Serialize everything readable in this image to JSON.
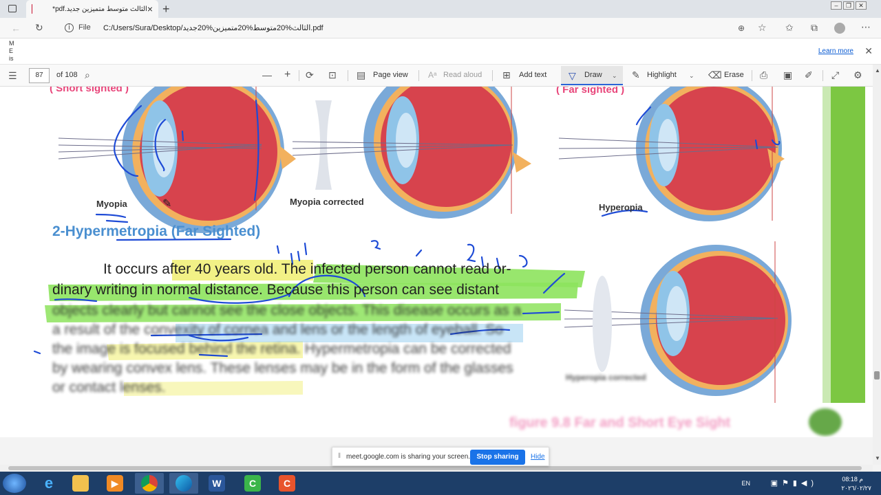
{
  "browser": {
    "tab_title": "الثالث متوسط متميزين جديد.pdf*",
    "file_label": "File",
    "url": "C:/Users/Sura/Desktop/الثالث%20متوسط%20متميزين%20جديد.pdf",
    "learn_more": "Learn more",
    "side_letters": "M E is"
  },
  "pdf_toolbar": {
    "page_number": "87",
    "page_total": "of 108",
    "page_view": "Page view",
    "read_aloud": "Read aloud",
    "add_text": "Add text",
    "draw": "Draw",
    "highlight": "Highlight",
    "erase": "Erase"
  },
  "document": {
    "header_left": "( Short sighted )",
    "header_right": "( Far sighted )",
    "label_myopia": "Myopia",
    "label_myopia_corrected": "Myopia corrected",
    "label_hyperopia": "Hyperopia",
    "section_title": "2-Hypermetropia (Far Sighted)",
    "para_line1": "It occurs after 40 years old. The infected person cannot read or-",
    "para_line2": "dinary writing in normal distance. Because this person can see distant",
    "para_line3": "objects clearly but cannot see the close objects. This disease occurs as a",
    "para_line4": "a result of the convexity of cornea and lens or the length of eyeball. So",
    "para_line5": "the image is focused behind the retina. Hypermetropia can be corrected",
    "para_line6": "by wearing convex lens. These lenses may be in the form of the glasses",
    "para_line7": "or contact lenses.",
    "label_hyperopia_corrected": "Hyperopia corrected",
    "figure_caption": "figure 9.8 Far and Short Eye Sight"
  },
  "share_banner": {
    "message": "meet.google.com is sharing your screen.",
    "stop_label": "Stop sharing",
    "hide_label": "Hide"
  },
  "taskbar": {
    "lang": "EN",
    "time": "08:18 م",
    "date": "٢٠٢٦/٠٢/٢٧"
  },
  "colors": {
    "accent_blue": "#1a73e8",
    "taskbar": "#1d3e68",
    "highlight_green": "#8de35d",
    "highlight_yellow": "#f1f079",
    "section_title": "#4a8fd0",
    "header_pink": "#e8457a",
    "eye_red": "#d7434d"
  }
}
